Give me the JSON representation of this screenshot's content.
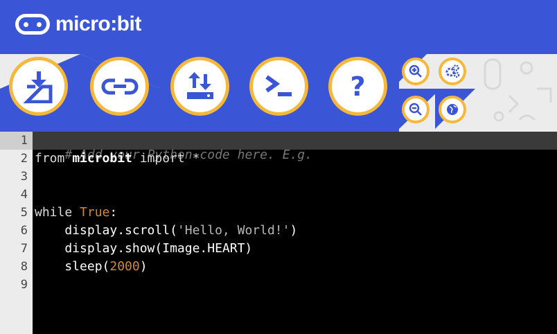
{
  "app": {
    "logo_text": "micro:bit"
  },
  "toolbar": {
    "buttons": [
      {
        "label": "Download",
        "icon": "download-icon"
      },
      {
        "label": "Connect",
        "icon": "connect-icon"
      },
      {
        "label": "Load/Save",
        "icon": "load-save-icon"
      },
      {
        "label": "Open Serial",
        "icon": "serial-icon"
      },
      {
        "label": "Help",
        "icon": "help-icon"
      }
    ],
    "small_buttons": [
      "zoom-in-icon",
      "settings-icon",
      "zoom-out-icon",
      "language-icon"
    ]
  },
  "editor": {
    "line_numbers": [
      "1",
      "2",
      "3",
      "4",
      "5",
      "6",
      "7",
      "8",
      "9"
    ],
    "lines": {
      "l1_comment": "# Add your Python code here. E.g.",
      "l2_from": "from",
      "l2_module": "microbit",
      "l2_import": "import *",
      "l5_while": "while",
      "l5_true": "True",
      "l5_colon": ":",
      "l6_a": "    display.scroll(",
      "l6_str": "'Hello, World!'",
      "l6_b": ")",
      "l7": "    display.show(Image.HEART)",
      "l8_a": "    sleep(",
      "l8_num": "2000",
      "l8_b": ")"
    }
  },
  "colors": {
    "brand_blue": "#3a55d6",
    "accent_yellow": "#f5b83b"
  }
}
